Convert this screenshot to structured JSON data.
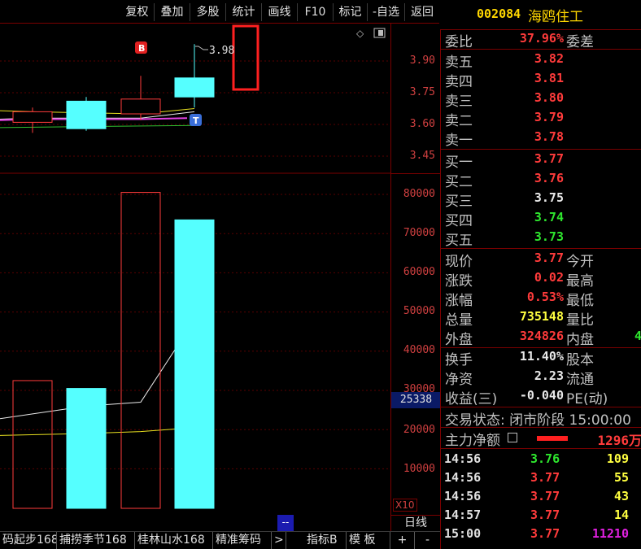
{
  "toolbar": {
    "buttons": [
      "复权",
      "叠加",
      "多股",
      "统计",
      "画线",
      "F10",
      "标记",
      "-自选",
      "返回"
    ]
  },
  "stock": {
    "code": "002084",
    "name": "海鸥住工"
  },
  "price_axis": {
    "ticks": [
      "3.90",
      "3.75",
      "3.60",
      "3.45"
    ]
  },
  "volume_axis": {
    "ticks": [
      "80000",
      "70000",
      "60000",
      "50000",
      "40000",
      "30000",
      "20000",
      "10000"
    ],
    "current": "25338",
    "multiplier": "X10"
  },
  "chart_annotations": {
    "high_label": "3.98",
    "buy_marker": "B",
    "t_marker": "T"
  },
  "chart_data": {
    "type": "candlestick",
    "candles": [
      {
        "open": 3.61,
        "close": 3.66,
        "high": 3.68,
        "low": 3.56,
        "direction": "up"
      },
      {
        "open": 3.58,
        "close": 3.71,
        "high": 3.73,
        "low": 3.57,
        "direction": "up"
      },
      {
        "open": 3.65,
        "close": 3.72,
        "high": 3.83,
        "low": 3.62,
        "direction": "up"
      },
      {
        "open": 3.73,
        "close": 3.82,
        "high": 3.98,
        "low": 3.68,
        "direction": "up"
      }
    ],
    "volumes": [
      32500,
      30500,
      80500,
      73500
    ],
    "volume_ma_white": [
      24000,
      26000,
      27000,
      48000
    ],
    "volume_ma_yellow": [
      19000,
      19000,
      19500,
      20500
    ],
    "price_ylim": [
      3.4,
      4.0
    ],
    "volume_ylim": [
      0,
      81000
    ]
  },
  "quote": {
    "weibi_label": "委比",
    "weibi_value": "37.96%",
    "weicha_label": "委差",
    "asks": [
      {
        "label": "卖五",
        "price": "3.82"
      },
      {
        "label": "卖四",
        "price": "3.81"
      },
      {
        "label": "卖三",
        "price": "3.80"
      },
      {
        "label": "卖二",
        "price": "3.79"
      },
      {
        "label": "卖一",
        "price": "3.78"
      }
    ],
    "bids": [
      {
        "label": "买一",
        "price": "3.77"
      },
      {
        "label": "买二",
        "price": "3.76"
      },
      {
        "label": "买三",
        "price": "3.75"
      },
      {
        "label": "买四",
        "price": "3.74"
      },
      {
        "label": "买五",
        "price": "3.73"
      }
    ],
    "stats1": [
      {
        "label": "现价",
        "value": "3.77",
        "label2": "今开",
        "value2": ""
      },
      {
        "label": "涨跌",
        "value": "0.02",
        "label2": "最高",
        "value2": ""
      },
      {
        "label": "涨幅",
        "value": "0.53%",
        "label2": "最低",
        "value2": ""
      },
      {
        "label": "总量",
        "value": "735148",
        "label2": "量比",
        "value2": ""
      },
      {
        "label": "外盘",
        "value": "324826",
        "label2": "内盘",
        "value2": "4"
      }
    ],
    "stats2": [
      {
        "label": "换手",
        "value": "11.40%",
        "label2": "股本",
        "value2": ""
      },
      {
        "label": "净资",
        "value": "2.23",
        "label2": "流通",
        "value2": ""
      },
      {
        "label": "收益(三)",
        "value": "-0.040",
        "label2": "PE(动)",
        "value2": ""
      }
    ],
    "status": "交易状态: 闭市阶段 15:00:00",
    "main_flow_label": "主力净额",
    "main_flow_value": "1296万"
  },
  "trades": [
    {
      "time": "14:56",
      "price": "3.76",
      "volume": "109"
    },
    {
      "time": "14:56",
      "price": "3.77",
      "volume": "55"
    },
    {
      "time": "14:56",
      "price": "3.77",
      "volume": "43"
    },
    {
      "time": "14:57",
      "price": "3.77",
      "volume": "14"
    },
    {
      "time": "15:00",
      "price": "3.77",
      "volume": "11210"
    }
  ],
  "bottom_tabs": [
    "码起步168",
    "捕捞季节168",
    "桂林山水168",
    "精准筹码",
    ">",
    "指标B",
    "模 板",
    "+",
    "-"
  ],
  "period": "日线",
  "scroll_label": "--"
}
